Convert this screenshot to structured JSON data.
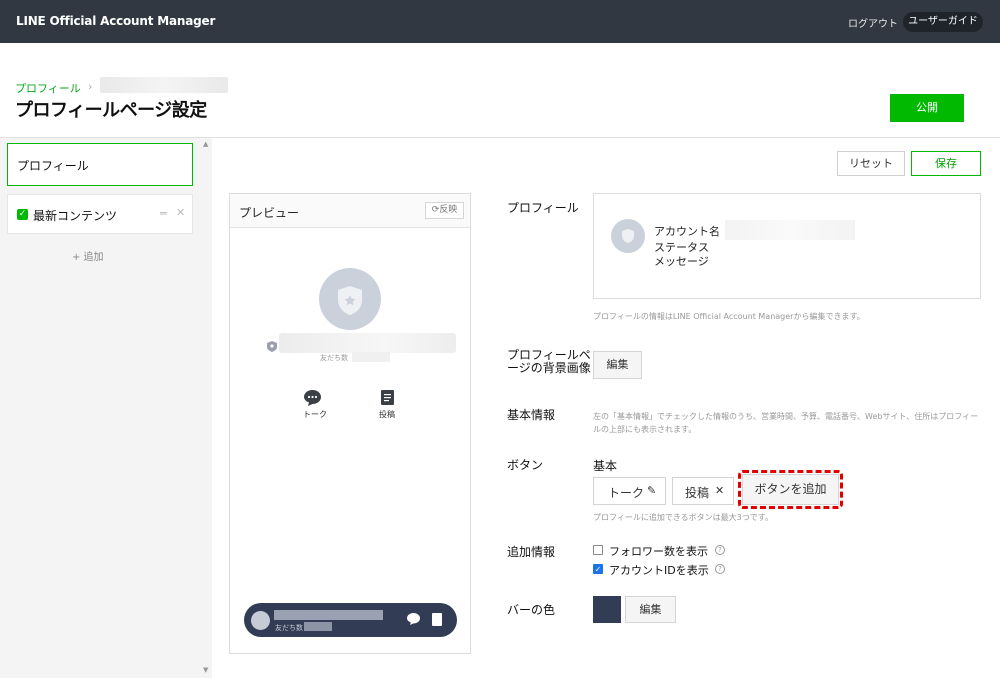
{
  "topbar": {
    "brand": "LINE Official Account Manager",
    "logout": "ログアウト",
    "user_guide": "ユーザーガイド"
  },
  "header": {
    "breadcrumb_root": "プロフィール",
    "breadcrumb_sep": "›",
    "title": "プロフィールページ設定",
    "publish": "公開"
  },
  "sidebar": {
    "items": [
      {
        "label": "プロフィール"
      },
      {
        "label": "最新コンテンツ"
      }
    ],
    "drag_glyph": "═",
    "remove_glyph": "✕",
    "add": "+ 追加"
  },
  "toolbar": {
    "reset": "リセット",
    "save": "保存"
  },
  "preview": {
    "title": "プレビュー",
    "reflect": "⟳反映",
    "friends_label": "友だち数",
    "talk": "トーク",
    "post": "投稿",
    "bar_friends_label": "友だち数"
  },
  "form": {
    "profile": {
      "label": "プロフィール",
      "account_name": "アカウント名",
      "status_message": "ステータスメッセージ",
      "help": "プロフィールの情報はLINE Official Account Managerから編集できます。"
    },
    "background": {
      "label": "プロフィールページの背景画像",
      "edit": "編集"
    },
    "basic_info": {
      "label": "基本情報",
      "help": "左の「基本情報」でチェックした情報のうち、営業時間、予算、電話番号、Webサイト、住所はプロフィールの上部にも表示されます。"
    },
    "buttons": {
      "label": "ボタン",
      "basic": "基本",
      "talk": "トーク",
      "talk_icon": "✎",
      "post": "投稿",
      "post_icon": "✕",
      "add": "ボタンを追加",
      "help": "プロフィールに追加できるボタンは最大3つです。"
    },
    "extra_info": {
      "label": "追加情報",
      "show_followers": "フォロワー数を表示",
      "show_followers_checked": false,
      "show_account_id": "アカウントIDを表示",
      "show_account_id_checked": true,
      "help_glyph": "?"
    },
    "bar_color": {
      "label": "バーの色",
      "color": "#323c55",
      "edit": "編集"
    }
  },
  "colors": {
    "accent": "#00b900",
    "topbar": "#323841",
    "highlight": "#e00000"
  }
}
